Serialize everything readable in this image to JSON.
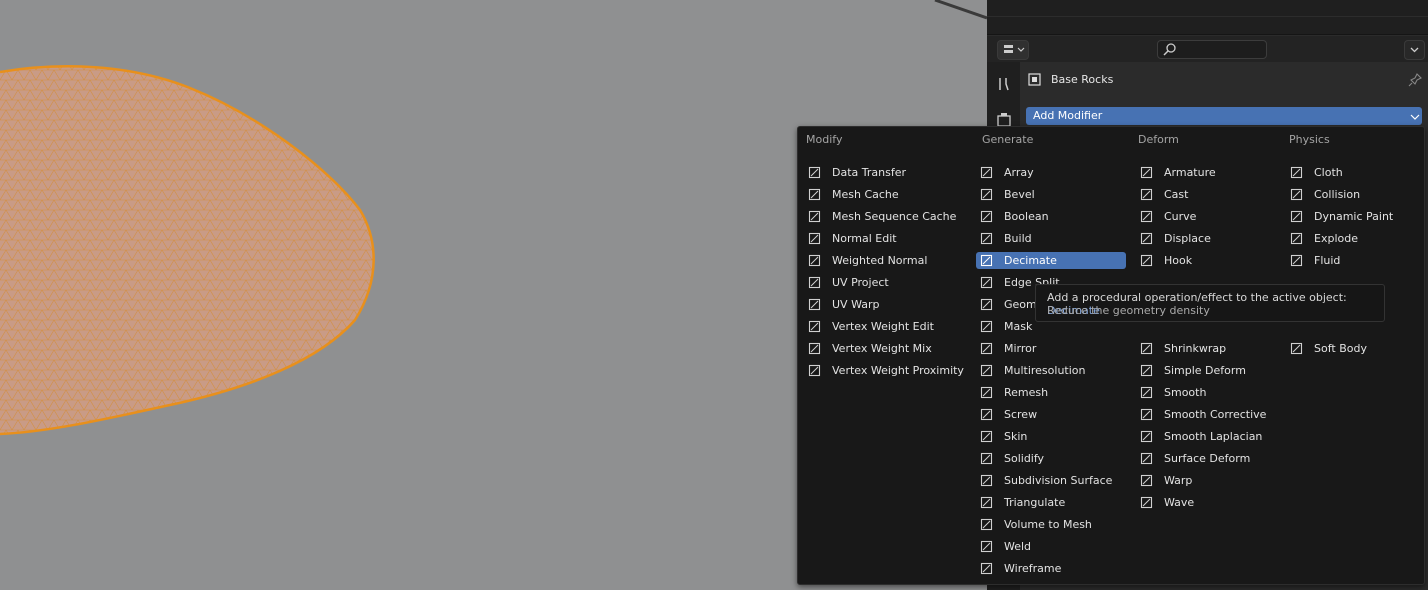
{
  "properties": {
    "object_name": "Base Rocks",
    "add_modifier_label": "Add Modifier"
  },
  "menu": {
    "columns": [
      {
        "heading": "Modify",
        "items": [
          {
            "label": "Data Transfer",
            "icon": "data-transfer-icon"
          },
          {
            "label": "Mesh Cache",
            "icon": "mesh-cache-icon"
          },
          {
            "label": "Mesh Sequence Cache",
            "icon": "mesh-sequence-cache-icon"
          },
          {
            "label": "Normal Edit",
            "icon": "normal-edit-icon"
          },
          {
            "label": "Weighted Normal",
            "icon": "weighted-normal-icon"
          },
          {
            "label": "UV Project",
            "icon": "uv-project-icon"
          },
          {
            "label": "UV Warp",
            "icon": "uv-warp-icon"
          },
          {
            "label": "Vertex Weight Edit",
            "icon": "vertex-weight-icon"
          },
          {
            "label": "Vertex Weight Mix",
            "icon": "vertex-weight-icon"
          },
          {
            "label": "Vertex Weight Proximity",
            "icon": "vertex-weight-icon"
          }
        ]
      },
      {
        "heading": "Generate",
        "items": [
          {
            "label": "Array",
            "icon": "array-icon"
          },
          {
            "label": "Bevel",
            "icon": "bevel-icon"
          },
          {
            "label": "Boolean",
            "icon": "boolean-icon"
          },
          {
            "label": "Build",
            "icon": "build-icon"
          },
          {
            "label": "Decimate",
            "icon": "decimate-icon",
            "active": true
          },
          {
            "label": "Edge Split",
            "icon": "edge-split-icon"
          },
          {
            "label": "Geom",
            "icon": "geometry-nodes-icon"
          },
          {
            "label": "Mask",
            "icon": "mask-icon"
          },
          {
            "label": "Mirror",
            "icon": "mirror-icon"
          },
          {
            "label": "Multiresolution",
            "icon": "multiresolution-icon"
          },
          {
            "label": "Remesh",
            "icon": "remesh-icon"
          },
          {
            "label": "Screw",
            "icon": "screw-icon"
          },
          {
            "label": "Skin",
            "icon": "skin-icon"
          },
          {
            "label": "Solidify",
            "icon": "solidify-icon"
          },
          {
            "label": "Subdivision Surface",
            "icon": "subdivision-surface-icon"
          },
          {
            "label": "Triangulate",
            "icon": "triangulate-icon"
          },
          {
            "label": "Volume to Mesh",
            "icon": "volume-to-mesh-icon"
          },
          {
            "label": "Weld",
            "icon": "weld-icon"
          },
          {
            "label": "Wireframe",
            "icon": "wireframe-icon"
          }
        ]
      },
      {
        "heading": "Deform",
        "items": [
          {
            "label": "Armature",
            "icon": "armature-icon"
          },
          {
            "label": "Cast",
            "icon": "cast-icon"
          },
          {
            "label": "Curve",
            "icon": "curve-icon"
          },
          {
            "label": "Displace",
            "icon": "displace-icon"
          },
          {
            "label": "Hook",
            "icon": "hook-icon"
          },
          {
            "label": "",
            "icon": ""
          },
          {
            "label": "",
            "icon": ""
          },
          {
            "label": "",
            "icon": ""
          },
          {
            "label": "Shrinkwrap",
            "icon": "shrinkwrap-icon"
          },
          {
            "label": "Simple Deform",
            "icon": "simple-deform-icon"
          },
          {
            "label": "Smooth",
            "icon": "smooth-icon"
          },
          {
            "label": "Smooth Corrective",
            "icon": "smooth-icon"
          },
          {
            "label": "Smooth Laplacian",
            "icon": "smooth-icon"
          },
          {
            "label": "Surface Deform",
            "icon": "surface-deform-icon"
          },
          {
            "label": "Warp",
            "icon": "warp-icon"
          },
          {
            "label": "Wave",
            "icon": "wave-icon"
          }
        ]
      },
      {
        "heading": "Physics",
        "items": [
          {
            "label": "Cloth",
            "icon": "cloth-icon"
          },
          {
            "label": "Collision",
            "icon": "collision-icon"
          },
          {
            "label": "Dynamic Paint",
            "icon": "dynamic-paint-icon"
          },
          {
            "label": "Explode",
            "icon": "explode-icon"
          },
          {
            "label": "Fluid",
            "icon": "fluid-icon"
          },
          {
            "label": "",
            "icon": ""
          },
          {
            "label": "",
            "icon": ""
          },
          {
            "label": "",
            "icon": ""
          },
          {
            "label": "Soft Body",
            "icon": "soft-body-icon"
          }
        ]
      }
    ]
  },
  "tooltip": {
    "line1_prefix": "Add a procedural operation/effect to the active object:",
    "line1_highlight": "Decimate",
    "line2": "Reduce the geometry density"
  },
  "colors": {
    "accent": "#4772b3",
    "wire": "#e8901c",
    "viewport_bg": "#8f9091"
  }
}
